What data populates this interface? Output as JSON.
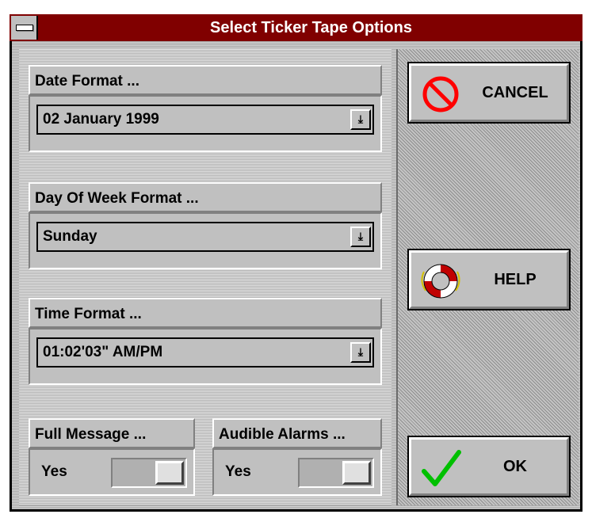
{
  "window": {
    "title": "Select Ticker Tape Options"
  },
  "date_format": {
    "label": "Date Format ...",
    "value": "02 January 1999"
  },
  "day_format": {
    "label": "Day Of Week Format ...",
    "value": "Sunday"
  },
  "time_format": {
    "label": "Time Format ...",
    "value": "01:02'03\" AM/PM"
  },
  "full_message": {
    "label": "Full Message ...",
    "value": "Yes"
  },
  "audible_alarms": {
    "label": "Audible Alarms ...",
    "value": "Yes"
  },
  "buttons": {
    "cancel": "CANCEL",
    "help": "HELP",
    "ok": "OK"
  },
  "icons": {
    "cancel": "no-entry-icon",
    "help": "life-preserver-icon",
    "ok": "checkmark-icon"
  },
  "colors": {
    "titlebar": "#800000",
    "cancel_icon": "#ff0000",
    "ok_icon": "#00c000"
  }
}
